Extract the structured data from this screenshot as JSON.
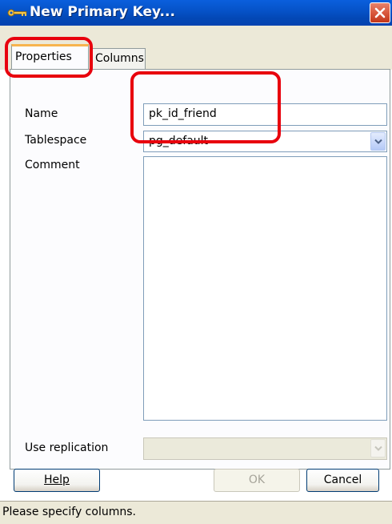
{
  "window": {
    "title": "New Primary Key...",
    "title_icon": "key-icon",
    "close_icon": "close-icon"
  },
  "tabs": [
    {
      "label": "Properties",
      "active": true
    },
    {
      "label": "Columns",
      "active": false
    }
  ],
  "form": {
    "name_label": "Name",
    "name_value": "pk_id_friend",
    "tablespace_label": "Tablespace",
    "tablespace_value": "pg_default",
    "comment_label": "Comment",
    "comment_value": "",
    "replication_label": "Use replication",
    "replication_value": ""
  },
  "buttons": {
    "help_label": "Help",
    "ok_label": "OK",
    "cancel_label": "Cancel"
  },
  "status": {
    "text": "Please specify columns."
  },
  "colors": {
    "titlebar": "#0653c9",
    "highlight": "#e8000d",
    "window_bg": "#ece9d8",
    "field_border": "#7f9db9"
  }
}
